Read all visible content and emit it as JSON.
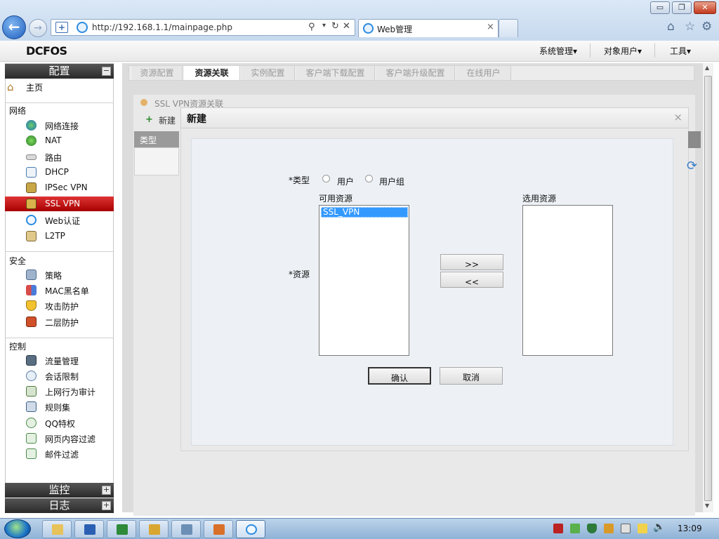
{
  "browser": {
    "url": "http://192.168.1.1/mainpage.php",
    "tab_title": "Web管理",
    "window_buttons": {
      "minimize": "▭",
      "restore": "❐",
      "close": "✕"
    }
  },
  "app": {
    "logo": "DCFOS",
    "header_menu": [
      "系统管理▾",
      "对象用户▾",
      "工具▾"
    ]
  },
  "sidebar": {
    "config_title": "配置",
    "home": "主页",
    "groups": [
      {
        "title": "网络",
        "items": [
          "网络连接",
          "NAT",
          "路由",
          "DHCP",
          "IPSec VPN",
          "SSL VPN",
          "Web认证",
          "L2TP"
        ]
      },
      {
        "title": "安全",
        "items": [
          "策略",
          "MAC黑名单",
          "攻击防护",
          "二层防护"
        ]
      },
      {
        "title": "控制",
        "items": [
          "流量管理",
          "会话限制",
          "上网行为审计",
          "规则集",
          "QQ特权",
          "网页内容过滤",
          "邮件过滤"
        ]
      }
    ],
    "active_item": "SSL VPN",
    "bottom_sections": [
      "监控",
      "日志"
    ],
    "toggle_minus": "−",
    "toggle_plus": "+"
  },
  "page_tabs": [
    "资源配置",
    "资源关联",
    "实例配置",
    "客户端下载配置",
    "客户端升级配置",
    "在线用户"
  ],
  "active_tab": "资源关联",
  "content": {
    "section_title": "SSL VPN资源关联",
    "new_button": "新建",
    "column_type": "类型"
  },
  "modal": {
    "title": "新建",
    "close": "×",
    "type_label": "*类型",
    "radio_user": "用户",
    "radio_group": "用户组",
    "resource_label": "*资源",
    "available_label": "可用资源",
    "selected_label": "选用资源",
    "available_items": [
      "SSL_VPN"
    ],
    "add_btn": ">>",
    "remove_btn": "<<",
    "ok_btn": "确认",
    "cancel_btn": "取消"
  },
  "taskbar": {
    "clock": "13:09"
  },
  "colors": {
    "active_sidebar": "#c80000",
    "sidebar_header": "#333333",
    "selected_list_item": "#3399ff"
  }
}
